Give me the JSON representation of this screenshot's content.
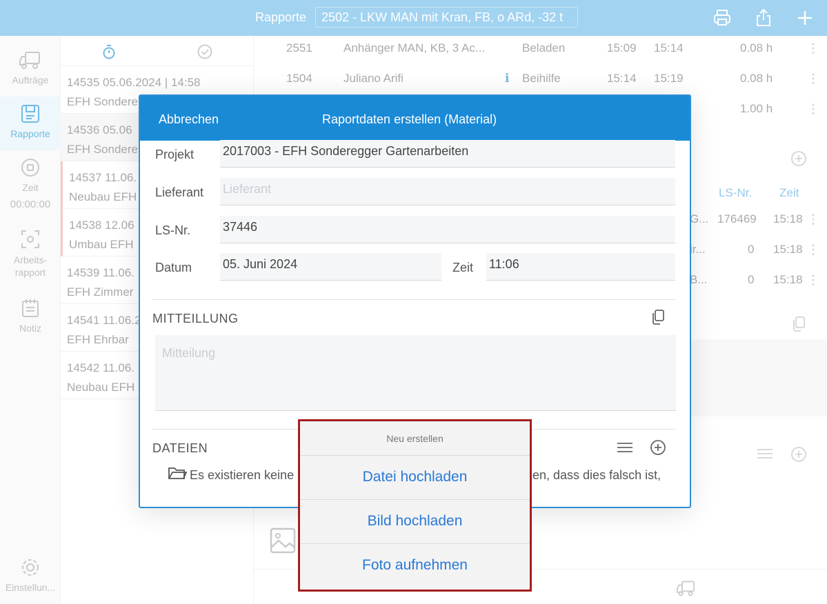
{
  "topbar": {
    "title": "Rapporte",
    "project": "2502 - LKW MAN mit Kran, FB, o ARd, -32 t"
  },
  "sidebar": {
    "items": [
      {
        "label": "Aufträge",
        "icon": "truck-icon"
      },
      {
        "label": "Rapporte",
        "icon": "report-icon"
      },
      {
        "label": "Zeit",
        "icon": "stop-icon",
        "time": "00:00:00"
      },
      {
        "label": "Arbeits-rapport",
        "icon": "scan-icon"
      },
      {
        "label": "Notiz",
        "icon": "notes-icon"
      }
    ],
    "settings_label": "Einstellun..."
  },
  "list": {
    "rows": [
      {
        "line1": "14535  05.06.2024 | 14:58",
        "line2": "EFH Sondere"
      },
      {
        "line1": "14536  05.06",
        "line2": "EFH Sondere"
      },
      {
        "line1": "14537  11.06.",
        "line2": "Neubau EFH"
      },
      {
        "line1": "14538  12.06",
        "line2": "Umbau EFH"
      },
      {
        "line1": "14539  11.06.",
        "line2": "EFH Zimmer"
      },
      {
        "line1": "14541  11.06.2",
        "line2": "EFH Ehrbar"
      },
      {
        "line1": "14542  11.06.",
        "line2": "Neubau EFH"
      }
    ]
  },
  "detail": {
    "rows": [
      {
        "nr": "2551",
        "name": "Anhänger MAN, KB, 3 Ac...",
        "type": "Beladen",
        "start": "15:09",
        "end": "15:14",
        "hours": "0.08 h"
      },
      {
        "nr": "1504",
        "name": "Juliano Arifi",
        "type": "Beihilfe",
        "start": "15:14",
        "end": "15:19",
        "hours": "0.08 h"
      },
      {
        "nr": "",
        "name": "",
        "type": "",
        "start": "",
        "end": "",
        "hours": "1.00 h"
      }
    ],
    "material_headers": {
      "ls": "LS-Nr.",
      "time": "Zeit"
    },
    "material_rows": [
      {
        "name": "G...",
        "ls": "176469",
        "time": "15:18"
      },
      {
        "name": "ir...",
        "ls": "0",
        "time": "15:18"
      },
      {
        "name": "B...",
        "ls": "0",
        "time": "15:18"
      }
    ]
  },
  "modal": {
    "cancel": "Abbrechen",
    "title": "Raportdaten erstellen (Material)",
    "projekt_label": "Projekt",
    "projekt_value": "2017003 - EFH Sonderegger Gartenarbeiten",
    "lieferant_label": "Lieferant",
    "lieferant_placeholder": "Lieferant",
    "ls_label": "LS-Nr.",
    "ls_value": "37446",
    "datum_label": "Datum",
    "datum_value": "05. Juni 2024",
    "zeit_label": "Zeit",
    "zeit_value": "11:06",
    "mitteilung_title": "MITTEILLUNG",
    "mitteilung_placeholder": "Mitteilung",
    "dateien_title": "DATEIEN",
    "empty_left": "Es existieren keine",
    "empty_right": "en, dass dies falsch ist,"
  },
  "action_sheet": {
    "title": "Neu erstellen",
    "items": [
      "Datei hochladen",
      "Bild hochladen",
      "Foto aufnehmen"
    ]
  },
  "colors": {
    "topbar": "#7fc3ea",
    "modal_header": "#1a8ad6",
    "accent": "#3aa0d9",
    "action_text": "#2979d6",
    "highlight_border": "#a51d1d"
  }
}
